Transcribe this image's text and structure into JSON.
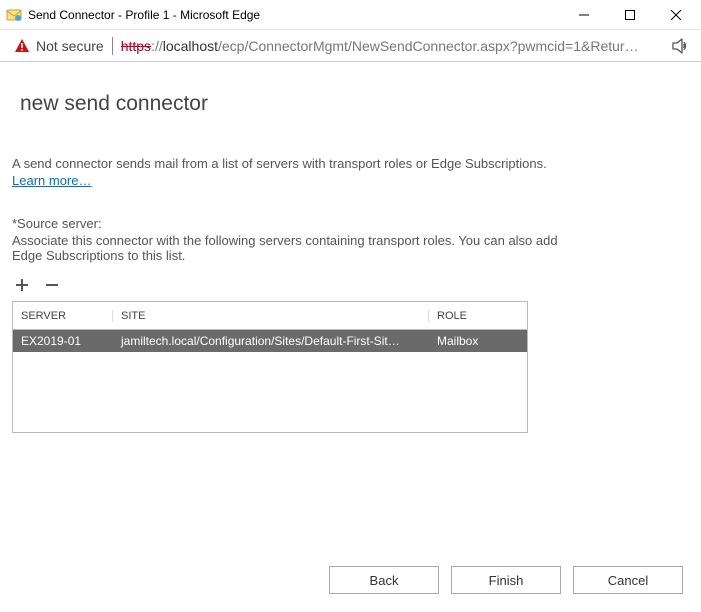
{
  "window": {
    "title": "Send Connector - Profile 1 - Microsoft Edge"
  },
  "address": {
    "security_label": "Not secure",
    "url_protocol": "https",
    "url_sep": "://",
    "url_host": "localhost",
    "url_path": "/ecp/ConnectorMgmt/NewSendConnector.aspx?pwmcid=1&Retur…"
  },
  "page": {
    "title": "new send connector",
    "description": "A send connector sends mail from a list of servers with transport roles or Edge Subscriptions.",
    "learn_more": "Learn more…",
    "section_label": "*Source server:",
    "section_help": "Associate this connector with the following servers containing transport roles. You can also add Edge Subscriptions to this list."
  },
  "grid": {
    "headers": {
      "server": "SERVER",
      "site": "SITE",
      "role": "ROLE"
    },
    "row": {
      "server": "EX2019-01",
      "site": "jamiltech.local/Configuration/Sites/Default-First-Sit…",
      "role": "Mailbox"
    }
  },
  "buttons": {
    "back": "Back",
    "finish": "Finish",
    "cancel": "Cancel"
  }
}
